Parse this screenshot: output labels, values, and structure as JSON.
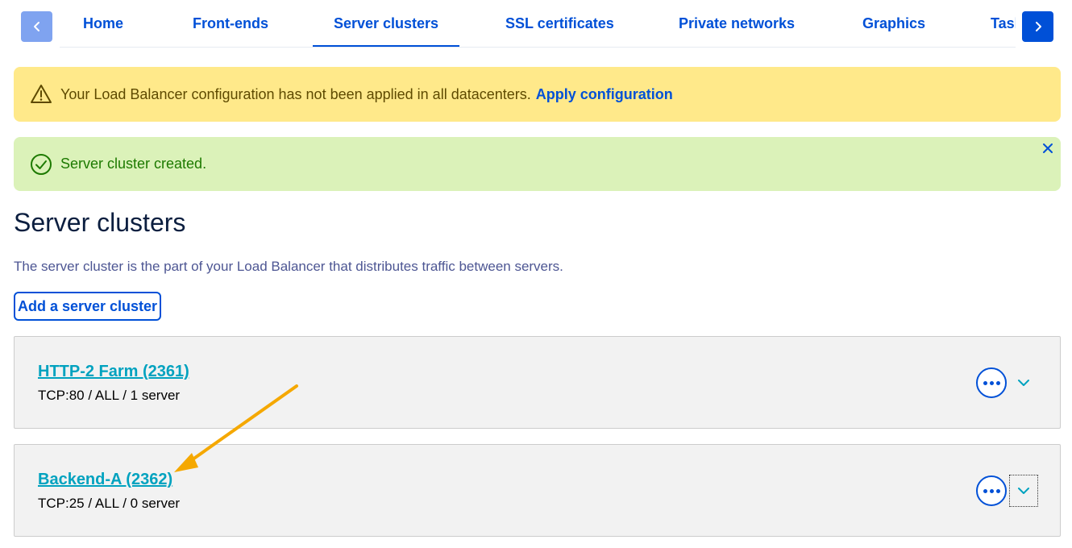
{
  "tabs": {
    "items": [
      {
        "label": "Home"
      },
      {
        "label": "Front-ends"
      },
      {
        "label": "Server clusters"
      },
      {
        "label": "SSL certificates"
      },
      {
        "label": "Private networks"
      },
      {
        "label": "Graphics"
      },
      {
        "label": "Tasks"
      }
    ],
    "active_index": 2
  },
  "alerts": {
    "warning": {
      "message": "Your Load Balancer configuration has not been applied in all datacenters.",
      "link": "Apply configuration"
    },
    "success": {
      "message": "Server cluster created."
    }
  },
  "page": {
    "title": "Server clusters",
    "description": "The server cluster is the part of your Load Balancer that distributes traffic between servers.",
    "add_button": "Add a server cluster"
  },
  "clusters": [
    {
      "title": "HTTP-2 Farm (2361)",
      "meta": "TCP:80 / ALL / 1 server"
    },
    {
      "title": "Backend-A (2362)",
      "meta": "TCP:25 / ALL / 0 server"
    }
  ],
  "colors": {
    "primary": "#0050d7",
    "link": "#00a2bf",
    "warning_bg": "#ffe98a",
    "success_bg": "#dbf2b9",
    "annotation_arrow": "#f5a800"
  }
}
